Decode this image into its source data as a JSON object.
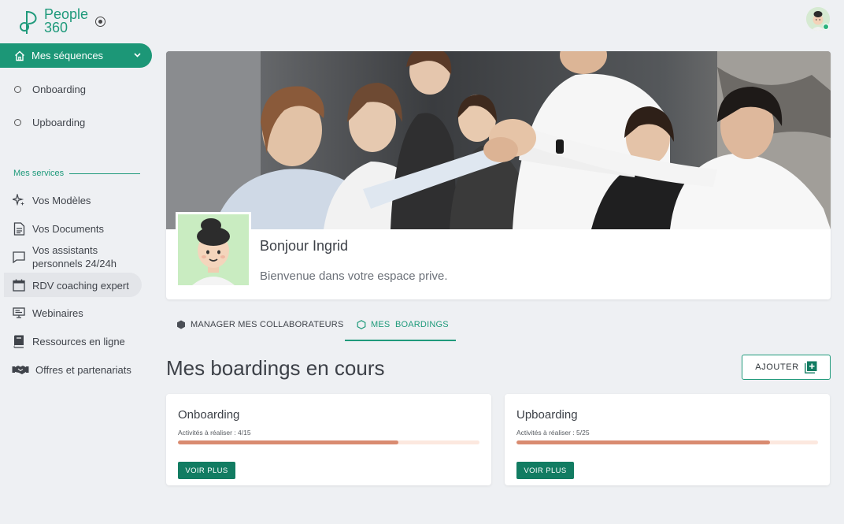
{
  "brand": {
    "name_line1": "People",
    "name_line2": "360",
    "color": "#1f9a7b"
  },
  "sidebar": {
    "active_item": {
      "label": "Mes séquences",
      "icon": "home-icon"
    },
    "sequences": [
      {
        "label": "Onboarding"
      },
      {
        "label": "Upboarding"
      }
    ],
    "services_label": "Mes services",
    "services": [
      {
        "label": "Vos Modèles",
        "icon": "sparkles-icon"
      },
      {
        "label": "Vos Documents",
        "icon": "document-icon"
      },
      {
        "label_line1": "Vos assistants",
        "label_line2": "personnels 24/24h",
        "icon": "chat-icon"
      },
      {
        "label": "RDV coaching expert",
        "icon": "calendar-icon"
      },
      {
        "label": "Webinaires",
        "icon": "presentation-icon"
      },
      {
        "label": "Ressources en ligne",
        "icon": "book-icon"
      },
      {
        "label": "Offres et partenariats",
        "icon": "handshake-icon"
      }
    ]
  },
  "hero": {
    "greeting": "Bonjour Ingrid",
    "welcome": "Bienvenue dans votre espace prive."
  },
  "tabs": [
    {
      "label": "MANAGER MES COLLABORATEURS",
      "icon": "hexagon-filled-icon",
      "active": false
    },
    {
      "label": "MES  BOARDINGS",
      "icon": "hexagon-outline-icon",
      "active": true
    }
  ],
  "main": {
    "title": "Mes boardings en cours",
    "add_label": "AJOUTER"
  },
  "cards": [
    {
      "title": "Onboarding",
      "subtitle": "Activités à réaliser : 4/15",
      "progress": 0.73,
      "button": "VOIR PLUS"
    },
    {
      "title": "Upboarding",
      "subtitle": "Activités à réaliser : 5/25",
      "progress": 0.84,
      "button": "VOIR PLUS"
    }
  ],
  "colors": {
    "accent": "#1f9a7b",
    "button": "#127c62",
    "progress_fill": "#d98b70",
    "progress_track": "#fce8df"
  }
}
